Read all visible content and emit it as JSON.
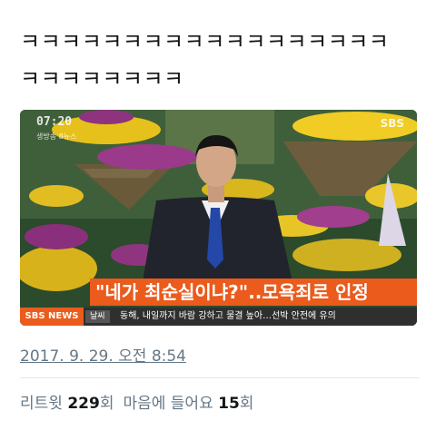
{
  "tweet": {
    "text": "ㅋㅋㅋㅋㅋㅋㅋㅋㅋㅋㅋㅋㅋㅋㅋㅋㅋㅋ\nㅋㅋㅋㅋㅋㅋㅋㅋ"
  },
  "media": {
    "clock": "07:20",
    "sub_label": "생방송 8뉴스",
    "channel_logo": "SBS",
    "caption": "\"네가 최순실이냐?\"..모욕죄로 인정",
    "ticker": {
      "logo": "SBS NEWS",
      "category": "날씨",
      "headline": "동해, 내일까지 바람 강하고 물결 높아…선박 안전에 유의"
    }
  },
  "timestamp": "2017. 9. 29. 오전 8:54",
  "stats": {
    "retweet_label": "리트윗",
    "retweet_count": "229",
    "retweet_unit": "회",
    "like_label": "마음에 들어요",
    "like_count": "15",
    "like_unit": "회"
  },
  "colors": {
    "caption_bg": "#ea5b1c",
    "link_gray": "#657786"
  }
}
